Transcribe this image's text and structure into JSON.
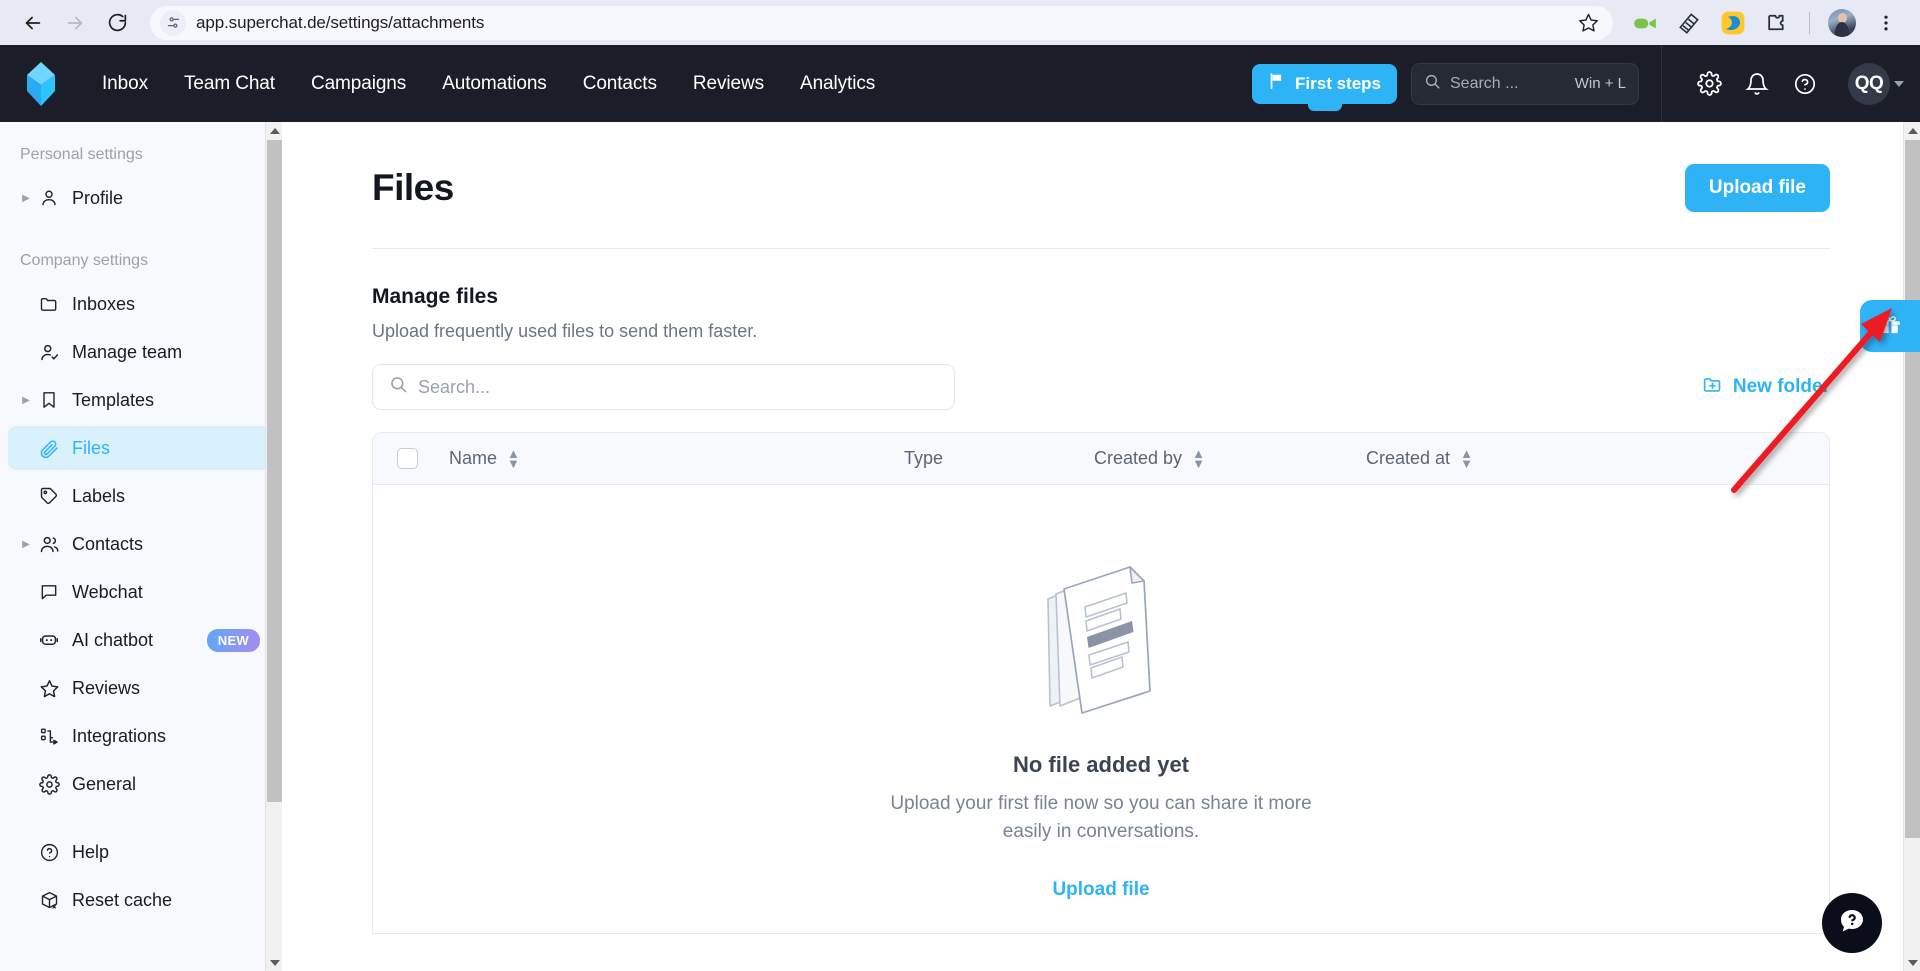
{
  "browser": {
    "url": "app.superchat.de/settings/attachments",
    "back_label": "Back",
    "forward_label": "Forward",
    "reload_label": "Reload",
    "site_info_label": "View site information",
    "bookmark_label": "Bookmark this tab",
    "extensions": [
      {
        "name": "screen-recorder-icon",
        "title": "Screen recorder"
      },
      {
        "name": "notes-icon",
        "title": "Notes"
      },
      {
        "name": "edit-highlight-icon",
        "title": "Highlighter"
      },
      {
        "name": "extensions-puzzle-icon",
        "title": "Extensions"
      }
    ],
    "profile_label": "Profile",
    "menu_label": "Customize and control Chrome"
  },
  "app_header": {
    "logo_name": "superchat-logo",
    "nav": [
      {
        "label": "Inbox"
      },
      {
        "label": "Team Chat"
      },
      {
        "label": "Campaigns"
      },
      {
        "label": "Automations"
      },
      {
        "label": "Contacts"
      },
      {
        "label": "Reviews"
      },
      {
        "label": "Analytics"
      }
    ],
    "first_steps_label": "First steps",
    "search_placeholder": "Search ...",
    "search_shortcut": "Win + L",
    "settings_label": "Settings",
    "notifications_label": "Notifications",
    "help_label": "Help",
    "user_initials": "QQ"
  },
  "sidebar": {
    "group_personal": "Personal settings",
    "group_company": "Company settings",
    "personal_items": [
      {
        "label": "Profile",
        "icon": "user-icon",
        "expandable": true
      }
    ],
    "company_items": [
      {
        "label": "Inboxes",
        "icon": "folder-icon",
        "expandable": false
      },
      {
        "label": "Manage team",
        "icon": "user-check-icon",
        "expandable": false
      },
      {
        "label": "Templates",
        "icon": "bookmark-icon",
        "expandable": true
      },
      {
        "label": "Files",
        "icon": "paperclip-icon",
        "expandable": false,
        "active": true
      },
      {
        "label": "Labels",
        "icon": "tag-icon",
        "expandable": false
      },
      {
        "label": "Contacts",
        "icon": "users-icon",
        "expandable": true
      },
      {
        "label": "Webchat",
        "icon": "chat-bubble-icon",
        "expandable": false
      },
      {
        "label": "AI chatbot",
        "icon": "robot-icon",
        "expandable": false,
        "badge": "NEW"
      },
      {
        "label": "Reviews",
        "icon": "star-icon",
        "expandable": false
      },
      {
        "label": "Integrations",
        "icon": "integrations-icon",
        "expandable": false
      },
      {
        "label": "General",
        "icon": "gear-icon",
        "expandable": false
      }
    ],
    "bottom_items": [
      {
        "label": "Help",
        "icon": "question-circle-icon",
        "expandable": false
      },
      {
        "label": "Reset cache",
        "icon": "box-x-icon",
        "expandable": false
      }
    ]
  },
  "main": {
    "page_title": "Files",
    "upload_button": "Upload file",
    "section_title": "Manage files",
    "section_subtitle": "Upload frequently used files to send them faster.",
    "search_placeholder": "Search...",
    "new_folder_label": "New folder",
    "table": {
      "columns": [
        {
          "label": "Name",
          "sortable": true
        },
        {
          "label": "Type",
          "sortable": false
        },
        {
          "label": "Created by",
          "sortable": true
        },
        {
          "label": "Created at",
          "sortable": true
        }
      ],
      "rows": []
    },
    "empty_state": {
      "title": "No file added yet",
      "subtitle": "Upload your first file now so you can share it more easily in conversations.",
      "link": "Upload file",
      "illustration": "stacked-documents-illustration"
    }
  },
  "widgets": {
    "gift_tab_label": "Gift",
    "help_bubble_label": "Help"
  },
  "colors": {
    "accent": "#2eb3f6",
    "header_bg": "#1b1e28",
    "sidebar_bg": "#f8f9fc",
    "active_item_bg": "#d9f0fd",
    "annotation_arrow": "#ee1b24"
  }
}
